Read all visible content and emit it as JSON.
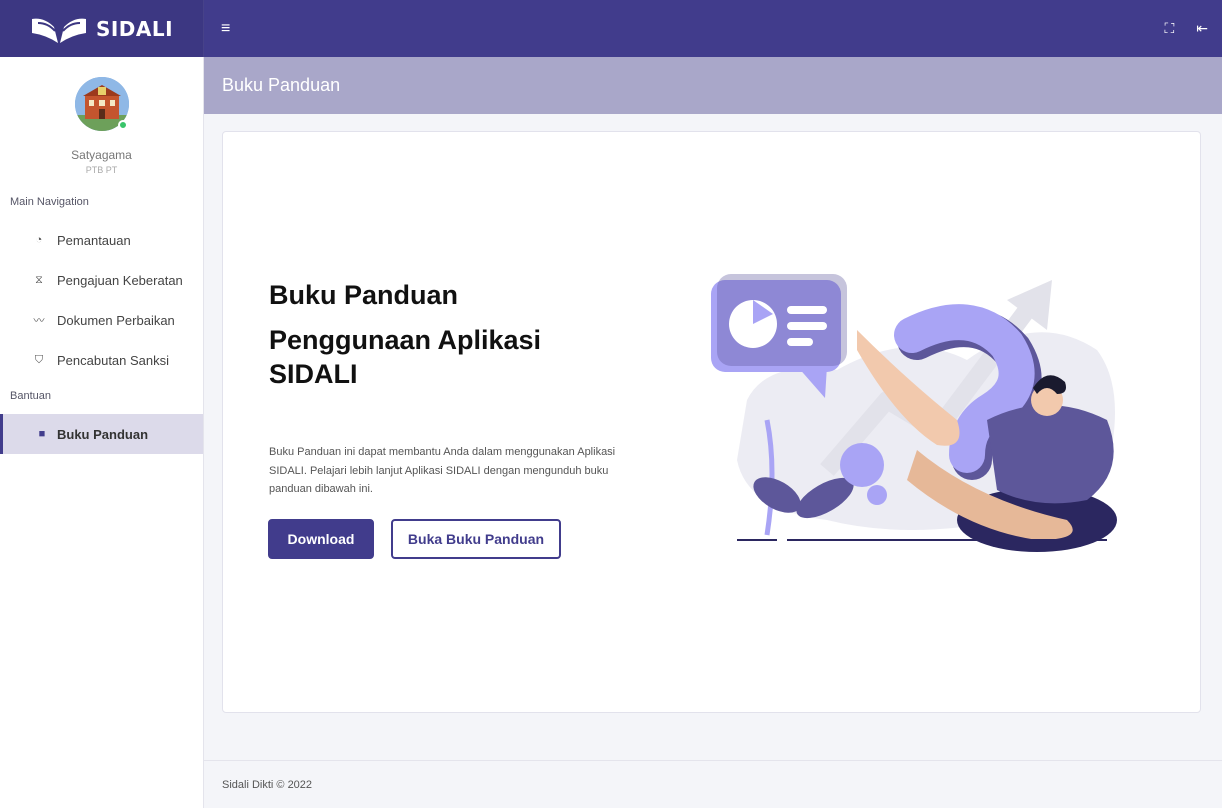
{
  "app": {
    "brand": "SIDALI"
  },
  "topbar": {
    "menu_icon": "menu-icon",
    "fullscreen_icon": "fullscreen-icon",
    "logout_icon": "logout-icon"
  },
  "user": {
    "name": "Satyagama",
    "role": "PTB PT",
    "status_color": "#39c46a"
  },
  "sidebar": {
    "main_header": "Main Navigation",
    "items": [
      {
        "label": "Pemantauan",
        "icon": "gauge-icon"
      },
      {
        "label": "Pengajuan Keberatan",
        "icon": "hourglass-icon"
      },
      {
        "label": "Dokumen Perbaikan",
        "icon": "chart-line-icon"
      },
      {
        "label": "Pencabutan Sanksi",
        "icon": "shield-icon"
      }
    ],
    "help_header": "Bantuan",
    "help_items": [
      {
        "label": "Buku Panduan",
        "icon": "book-icon",
        "active": true
      }
    ]
  },
  "page": {
    "title": "Buku Panduan"
  },
  "hero": {
    "title": "Buku Panduan",
    "subtitle": "Penggunaan Aplikasi SIDALI",
    "description": "Buku Panduan ini dapat membantu Anda dalam menggunakan Aplikasi SIDALI. Pelajari lebih lanjut Aplikasi SIDALI dengan mengunduh buku panduan dibawah ini.",
    "download_label": "Download",
    "open_label": "Buka Buku Panduan"
  },
  "footer": {
    "text": "Sidali Dikti © 2022"
  },
  "colors": {
    "primary": "#413c8c",
    "header_band": "#a9a7c9",
    "accent": "#a9a4f5"
  }
}
